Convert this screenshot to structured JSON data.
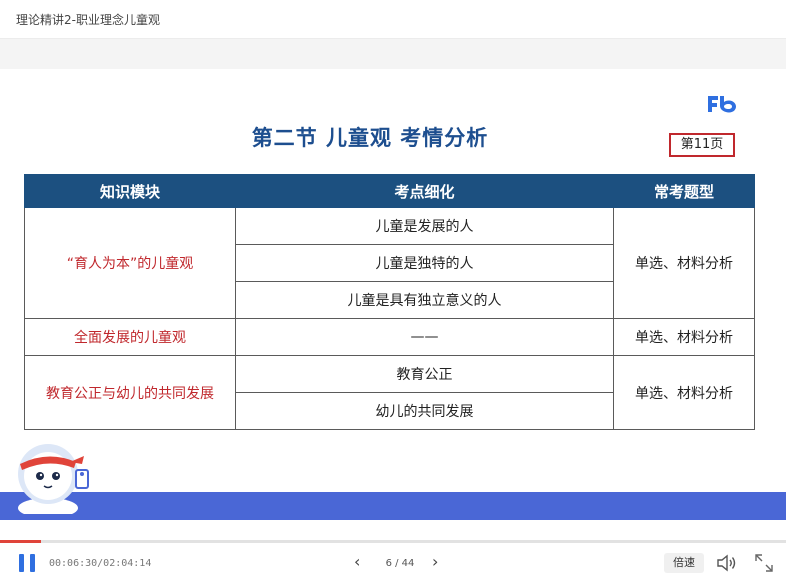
{
  "window": {
    "title": "理论精讲2-职业理念儿童观"
  },
  "slide": {
    "title": "第二节 儿童观 考情分析",
    "page_label": "第11页",
    "logo_icon": "fb-logo",
    "brand_color": "#2f6fe0",
    "table": {
      "headers": [
        "知识模块",
        "考点细化",
        "常考题型"
      ],
      "groups": [
        {
          "module": "“育人为本”的儿童观",
          "points": [
            "儿童是发展的人",
            "儿童是独特的人",
            "儿童是具有独立意义的人"
          ],
          "type": "单选、材料分析"
        },
        {
          "module": "全面发展的儿童观",
          "points": [
            "——"
          ],
          "type": "单选、材料分析"
        },
        {
          "module": "教育公正与幼儿的共同发展",
          "points": [
            "教育公正",
            "幼儿的共同发展"
          ],
          "type": "单选、材料分析"
        }
      ]
    }
  },
  "player": {
    "time": "00:06:30/02:04:14",
    "progress": 0.052,
    "page_indicator": "6 / 44",
    "speed_label": "倍速",
    "icons": [
      "pause-icon",
      "prev-icon",
      "next-icon",
      "volume-icon",
      "fullscreen-icon"
    ]
  }
}
